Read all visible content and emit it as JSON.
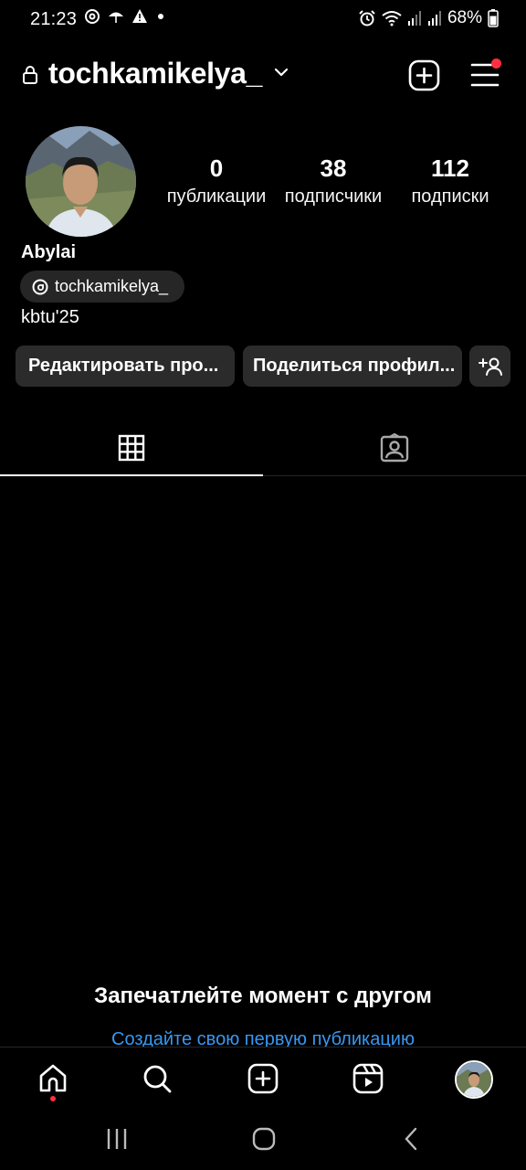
{
  "status_bar": {
    "time": "21:23",
    "battery_percent": "68%",
    "left_icons": [
      "threads-icon",
      "umbrella-icon",
      "warning-icon",
      "dot-icon"
    ],
    "right_icons": [
      "alarm-icon",
      "wifi-icon",
      "signal-icon",
      "signal-icon",
      "battery-icon"
    ]
  },
  "header": {
    "username": "tochkamikelya_",
    "notification_dot_color": "#ff3040"
  },
  "profile": {
    "stats": [
      {
        "value": "0",
        "label": "публикации"
      },
      {
        "value": "38",
        "label": "подписчики"
      },
      {
        "value": "112",
        "label": "подписки"
      }
    ],
    "display_name": "Abylai",
    "threads_handle": "tochkamikelya_",
    "bio": "kbtu'25"
  },
  "buttons": {
    "edit_profile": "Редактировать про...",
    "share_profile": "Поделиться профил..."
  },
  "tabs": [
    "grid-icon",
    "tagged-icon"
  ],
  "empty_state": {
    "title": "Запечатлейте момент с другом",
    "link": "Создайте свою первую публикацию",
    "link_color": "#3897f0"
  },
  "bottom_nav": [
    "home-icon",
    "search-icon",
    "create-icon",
    "reels-icon",
    "profile-avatar"
  ]
}
